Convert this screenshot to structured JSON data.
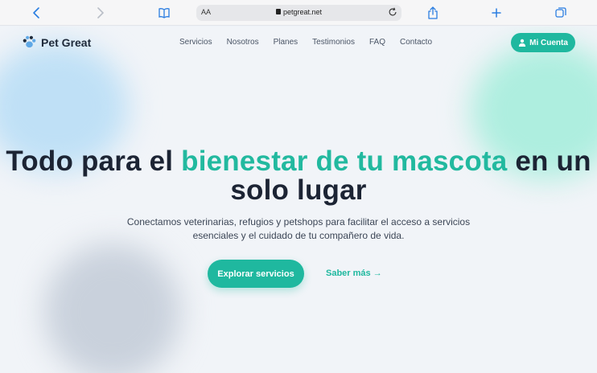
{
  "browser": {
    "text_size_label": "AA",
    "url": "petgreat.net"
  },
  "nav": {
    "brand": "Pet Great",
    "menu": [
      "Servicios",
      "Nosotros",
      "Planes",
      "Testimonios",
      "FAQ",
      "Contacto"
    ],
    "account_label": "Mi Cuenta"
  },
  "hero": {
    "title_part1": "Todo para el ",
    "title_accent": "bienestar de tu mascota",
    "title_part2": " en un solo lugar",
    "subtitle": "Conectamos veterinarias, refugios y petshops para facilitar el acceso a servicios esenciales y el cuidado de tu compañero de vida.",
    "primary_cta": "Explorar servicios",
    "secondary_cta": "Saber más →"
  },
  "colors": {
    "accent": "#1fb89f",
    "heading": "#1c2434",
    "browser_accent": "#2a7de1"
  }
}
